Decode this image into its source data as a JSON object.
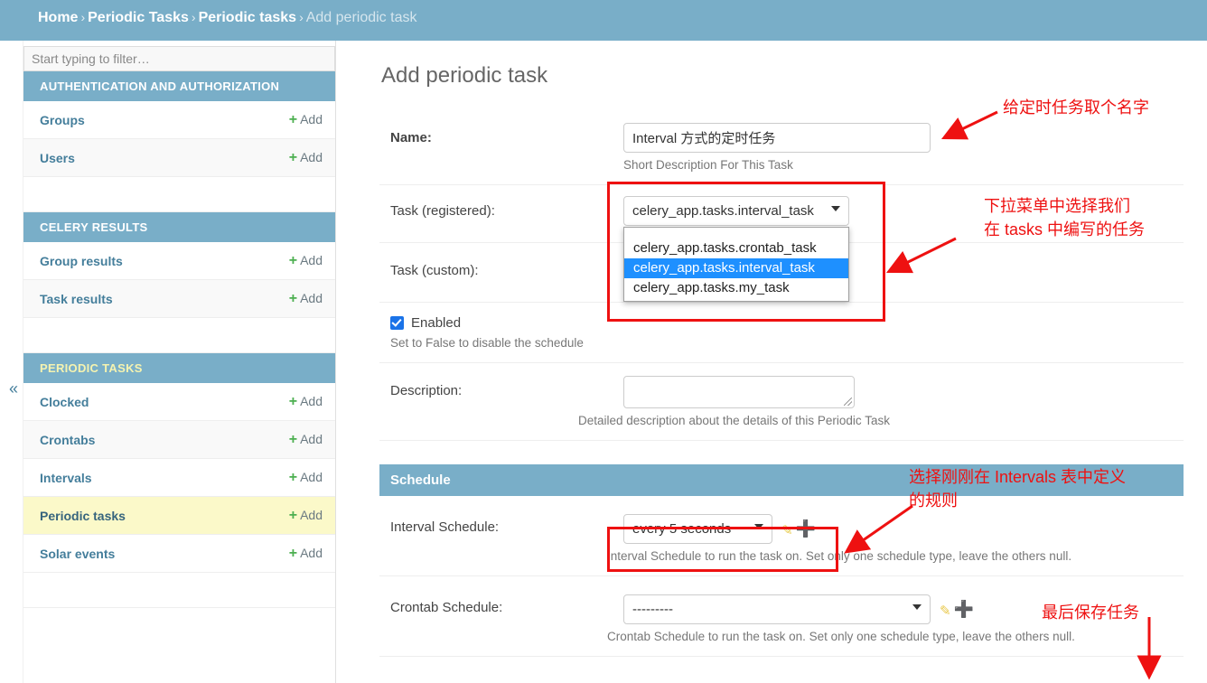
{
  "header": {
    "breadcrumbs": [
      {
        "label": "Home",
        "current": false
      },
      {
        "label": "Periodic Tasks",
        "current": false
      },
      {
        "label": "Periodic tasks",
        "current": false
      },
      {
        "label": "Add periodic task",
        "current": true
      }
    ],
    "separator": "›",
    "background": "#79aec8"
  },
  "sidebar": {
    "filter_placeholder": "Start typing to filter…",
    "filter_value": "",
    "collapse_icon": "«",
    "add_label": "Add",
    "plus_icon": "+",
    "apps": [
      {
        "name": "AUTHENTICATION AND AUTHORIZATION",
        "highlight": false,
        "models": [
          {
            "label": "Groups",
            "current": false
          },
          {
            "label": "Users",
            "current": false
          }
        ]
      },
      {
        "name": "CELERY RESULTS",
        "highlight": false,
        "models": [
          {
            "label": "Group results",
            "current": false
          },
          {
            "label": "Task results",
            "current": false
          }
        ]
      },
      {
        "name": "PERIODIC TASKS",
        "highlight": true,
        "models": [
          {
            "label": "Clocked",
            "current": false
          },
          {
            "label": "Crontabs",
            "current": false
          },
          {
            "label": "Intervals",
            "current": false
          },
          {
            "label": "Periodic tasks",
            "current": true
          },
          {
            "label": "Solar events",
            "current": false
          }
        ]
      }
    ]
  },
  "main": {
    "page_title": "Add periodic task",
    "fields": {
      "name": {
        "label": "Name:",
        "value": "Interval 方式的定时任务",
        "placeholder": "",
        "help": "Short Description For This Task"
      },
      "task_registered": {
        "label": "Task (registered):",
        "selected": "celery_app.tasks.interval_task",
        "options": [
          "celery_app.tasks.crontab_task",
          "celery_app.tasks.interval_task",
          "celery_app.tasks.my_task"
        ],
        "open": true
      },
      "task_custom": {
        "label": "Task (custom):",
        "value": ""
      },
      "enabled": {
        "label": "Enabled",
        "checked": true,
        "help": "Set to False to disable the schedule"
      },
      "description": {
        "label": "Description:",
        "value": "",
        "help": "Detailed description about the details of this Periodic Task"
      },
      "interval_schedule": {
        "label": "Interval Schedule:",
        "selected": "every 5 seconds",
        "help": "Interval Schedule to run the task on. Set only one schedule type, leave the others null."
      },
      "crontab_schedule": {
        "label": "Crontab Schedule:",
        "selected": "---------",
        "help": "Crontab Schedule to run the task on. Set only one schedule type, leave the others null."
      }
    },
    "schedule_section_title": "Schedule"
  },
  "annotations": {
    "color": "#ee1111",
    "items": [
      {
        "id": "name-note",
        "text": "给定时任务取个名字"
      },
      {
        "id": "task-note",
        "text": "下拉菜单中选择我们\n在 tasks 中编写的任务"
      },
      {
        "id": "interval-note",
        "text": "选择刚刚在 Intervals 表中定义\n的规则"
      },
      {
        "id": "save-note",
        "text": "最后保存任务"
      }
    ]
  }
}
